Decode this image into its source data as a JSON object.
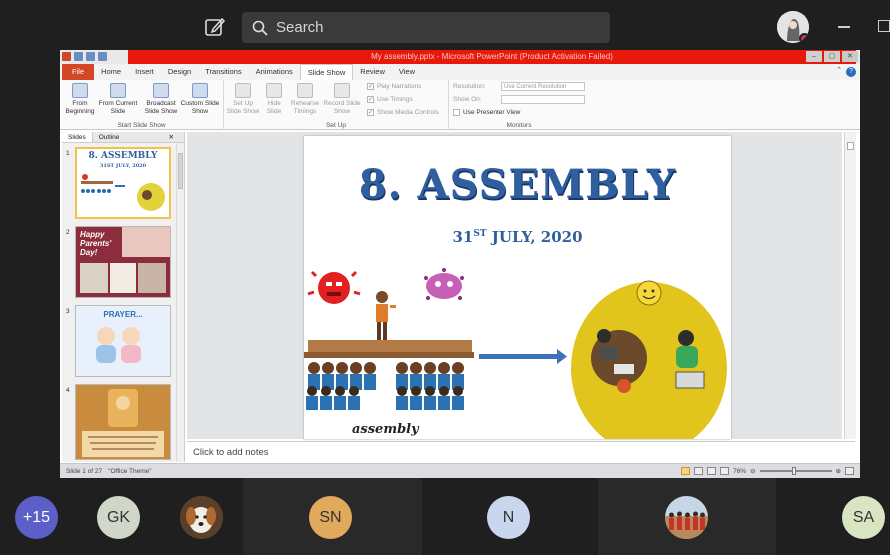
{
  "topbar": {
    "search_placeholder": "Search"
  },
  "ppt": {
    "window_title": "My assembly.pptx - Microsoft PowerPoint (Product Activation Failed)",
    "tabs": [
      "File",
      "Home",
      "Insert",
      "Design",
      "Transitions",
      "Animations",
      "Slide Show",
      "Review",
      "View"
    ],
    "active_tab": "Slide Show",
    "ribbon": {
      "from_beginning": "From Beginning",
      "from_current": "From Current Slide",
      "broadcast": "Broadcast Slide Show",
      "custom": "Custom Slide Show",
      "group_start": "Start Slide Show",
      "setup_show": "Set Up Slide Show",
      "hide_slide": "Hide Slide",
      "rehearse": "Rehearse Timings",
      "record": "Record Slide Show",
      "play_narrations": "Play Narrations",
      "use_timings": "Use Timings",
      "show_media": "Show Media Controls",
      "group_setup": "Set Up",
      "resolution_label": "Resolution:",
      "resolution_value": "Use Current Resolution",
      "show_on": "Show On:",
      "presenter_view": "Use Presenter View",
      "group_monitors": "Monitors"
    },
    "pane_tabs": {
      "slides": "Slides",
      "outline": "Outline"
    },
    "thumbnails": [
      {
        "num": "1",
        "title": "8. ASSEMBLY",
        "sub": "31ST JULY, 2020"
      },
      {
        "num": "2",
        "title": "Happy Parents' Day!"
      },
      {
        "num": "3",
        "title": "PRAYER..."
      },
      {
        "num": "4",
        "title": ""
      }
    ],
    "slide": {
      "title": "8. ASSEMBLY",
      "date_day": "31",
      "date_sup": "ST",
      "date_rest": "JULY, 2020",
      "caption": "assembly"
    },
    "notes_placeholder": "Click to add notes",
    "status": {
      "slide_of": "Slide 1 of 27",
      "theme": "\"Office Theme\"",
      "zoom": "76%"
    }
  },
  "participants": [
    {
      "initials": "+15",
      "color": "#5b5fc7"
    },
    {
      "initials": "GK",
      "color": "#d0d7c8"
    },
    {
      "initials": "SN",
      "color": "#e0a95b"
    },
    {
      "initials": "N",
      "color": "#c9d6ee"
    },
    {
      "initials": "SA",
      "color": "#d8e4c2"
    }
  ]
}
